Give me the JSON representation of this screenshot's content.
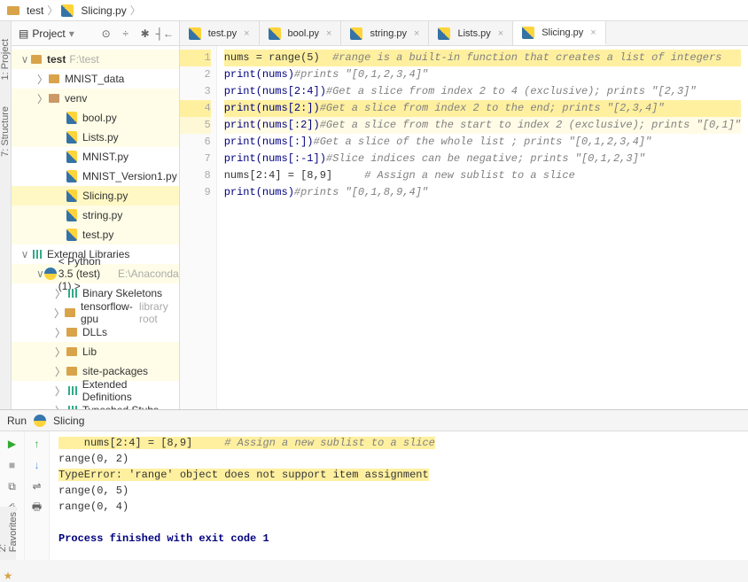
{
  "breadcrumb": {
    "root": "test",
    "file": "Slicing.py"
  },
  "dock": {
    "project": "1: Project",
    "structure": "7: Structure",
    "favorites": "2: Favorites"
  },
  "panel": {
    "title": "Project"
  },
  "tree": {
    "test": {
      "name": "test",
      "hint": "F:\\test"
    },
    "mnist": "MNIST_data",
    "venv": "venv",
    "bool": "bool.py",
    "lists": "Lists.py",
    "mnistpy": "MNIST.py",
    "mnistv1": "MNIST_Version1.py",
    "slicing": "Slicing.py",
    "string": "string.py",
    "testpy": "test.py",
    "extlib": "External Libraries",
    "py35": "< Python 3.5 (test) (1) >",
    "py35hint": "E:\\Anaconda",
    "binskel": "Binary Skeletons",
    "tfgpu": "tensorflow-gpu",
    "tfgpuhint": "library root",
    "dlls": "DLLs",
    "lib": "Lib",
    "sitepkg": "site-packages",
    "extdef": "Extended Definitions",
    "typeshed": "Typeshed Stubs"
  },
  "tabs": {
    "test": "test.py",
    "bool": "bool.py",
    "string": "string.py",
    "lists": "Lists.py",
    "slicing": "Slicing.py"
  },
  "code": {
    "l1a": "nums = range(5)  ",
    "l1b": "#range is a built-in function that creates a list of integers",
    "l2a": "print(nums)",
    "l2b": "#prints \"[0,1,2,3,4]\"",
    "l3a": "print(nums[2:4])",
    "l3b": "#Get a slice from index 2 to 4 (exclusive); prints \"[2,3]\"",
    "l4a": "print(nums[2:])",
    "l4b": "#Get a slice from index 2 to the end; prints \"[2,3,4]\"",
    "l5a": "print(nums[:2])",
    "l5b": "#Get a slice from the start to index 2 (exclusive); prints \"[0,1]\"",
    "l6a": "print(nums[:])",
    "l6b": "#Get a slice of the whole list ; prints \"[0,1,2,3,4]\"",
    "l7a": "print(nums[:-1])",
    "l7b": "#Slice indices can be negative; prints \"[0,1,2,3]\"",
    "l8a": "nums[2:4] = [8,9]     ",
    "l8b": "# Assign a new sublist to a slice",
    "l9a": "print(nums)",
    "l9b": "#prints \"[0,1,8,9,4]\""
  },
  "run": {
    "title": "Run",
    "config": "Slicing",
    "l1a": "    nums[2:4] = [8,9]     ",
    "l1b": "# Assign a new sublist to a slice",
    "l2": "range(0, 2)",
    "l3": "TypeError: 'range' object does not support item assignment",
    "l4": "range(0, 5)",
    "l5": "range(0, 4)",
    "l6": "Process finished with exit code 1"
  }
}
